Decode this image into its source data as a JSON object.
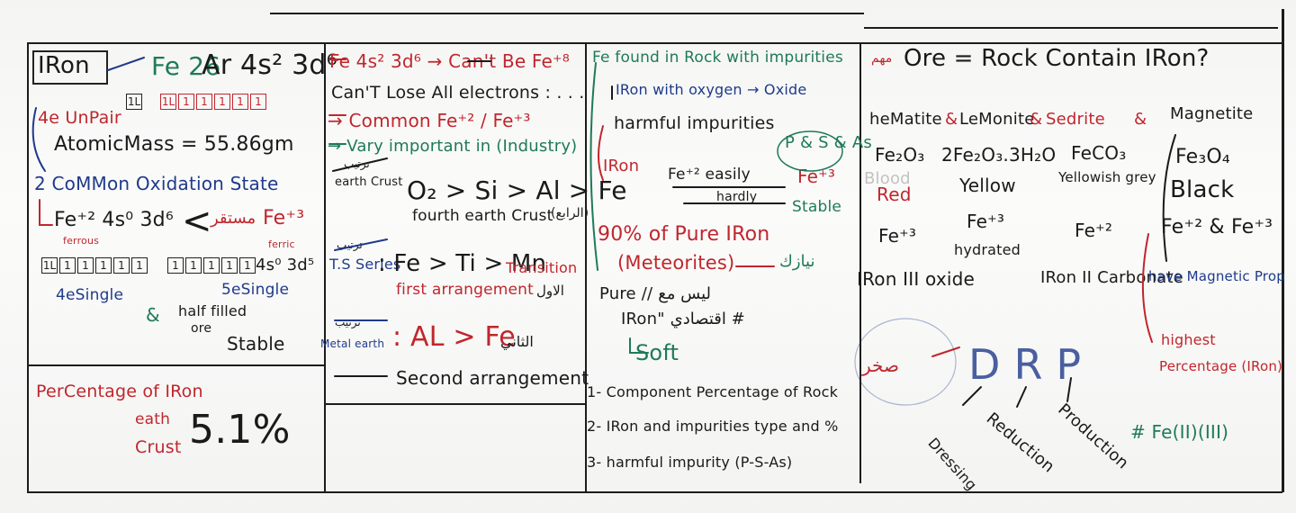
{
  "col1": {
    "iron": "IRon",
    "fe26": "Fe 26",
    "config": "Ar 4s² 3d⁶",
    "he_unpair": "4e UnPair",
    "one_l": "1L",
    "box_row": [
      "1L",
      "1",
      "1",
      "1",
      "1",
      "1"
    ],
    "atomic_mass": "AtomicMass = 55.86gm",
    "common_ox": "2 CoMMon Oxidation State",
    "fe2": "Fe⁺² 4s⁰ 3d⁶",
    "ferrous": "ferrous",
    "fe3": "Fe⁺³",
    "ferric": "ferric",
    "mustaqir": "مستقر",
    "config5": "4s⁰ 3d⁵",
    "row_a": [
      "1L",
      "1",
      "1",
      "1",
      "1",
      "1"
    ],
    "row_b": [
      "1",
      "1",
      "1",
      "1",
      "1"
    ],
    "he_single": "4eSingle",
    "and": "&",
    "five_single": "5eSingle",
    "half_filled": "half filled",
    "ore": "ore",
    "stable": "Stable",
    "percentage": "PerCentage of IRon",
    "earth": "eath",
    "crust": "Crust",
    "pct_value": "5.1%"
  },
  "col2": {
    "l1": "Fe 4s² 3d⁶ → Can't Be Fe⁺⁸",
    "l2": "Can'T Lose All electrons : . . .",
    "l3": "→ Common Fe⁺² / Fe⁺³",
    "l4": "→ Vary important in (Industry)",
    "tarteeb": "ترتيب",
    "earth_crust": "earth Crust",
    "order": "O₂ > Si > Al > Fe",
    "fourth": "fourth earth Crust",
    "raabi": "(الرابع)",
    "series": "T.S Series",
    "ts_order": ": Fe > Ti > Mn",
    "transition": "Transition",
    "first_arr": "first arrangement",
    "awwal": "الاول",
    "metal_earth": "Metal earth",
    "metal_order": ": AL > Fe",
    "thani": "الثاني",
    "second_arr": "Second arrangement"
  },
  "col3": {
    "found": "Fe found in Rock with impurities",
    "oxide": "IRon with oxygen → Oxide",
    "harmful": "harmful impurities",
    "psas": "P & S & As",
    "iron": "IRon",
    "fe2_easily": "Fe⁺² easily",
    "hardly": "hardly",
    "fe3": "Fe⁺³",
    "stable": "Stable",
    "pure": "90% of Pure IRon",
    "meteor": "(Meteorites)",
    "nayazek": "نيازك",
    "pure_iron": "Pure // ليس مع",
    "iron2": "IRon\" اقتصادي #",
    "soft": "Soft",
    "item1": "1- Component Percentage of Rock",
    "item2": "2- IRon and impurities type and %",
    "item3": "3- harmful impurity (P-S-As)"
  },
  "col4": {
    "muhim": "مهم",
    "ore_def": "Ore = Rock Contain IRon?",
    "ores": [
      "heMatite",
      "LeMonite",
      "Sedrite",
      "Magnetite"
    ],
    "amp": "&",
    "formulas": [
      "Fe₂O₃",
      "2Fe₂O₃.3H₂O",
      "FeCO₃",
      "Fe₃O₄"
    ],
    "colors": [
      "Red",
      "Yellow",
      "Yellowish grey",
      "Black"
    ],
    "blood": "Blood",
    "ox_states": [
      "Fe⁺³",
      "Fe⁺³",
      "Fe⁺²",
      "Fe⁺² & Fe⁺³"
    ],
    "hydrated": "hydrated",
    "iron3oxide": "IRon III oxide",
    "iron2carb": "IRon II Carbonate",
    "magnetic": "have Magnetic Prop",
    "highest": "highest",
    "percentage": "Percentage (IRon)",
    "feiiiii": "# Fe(II)(III)",
    "sakhr": "صخر",
    "drp": "D R P",
    "dressing": "Dressing",
    "reduction": "Reduction",
    "production": "Production"
  }
}
